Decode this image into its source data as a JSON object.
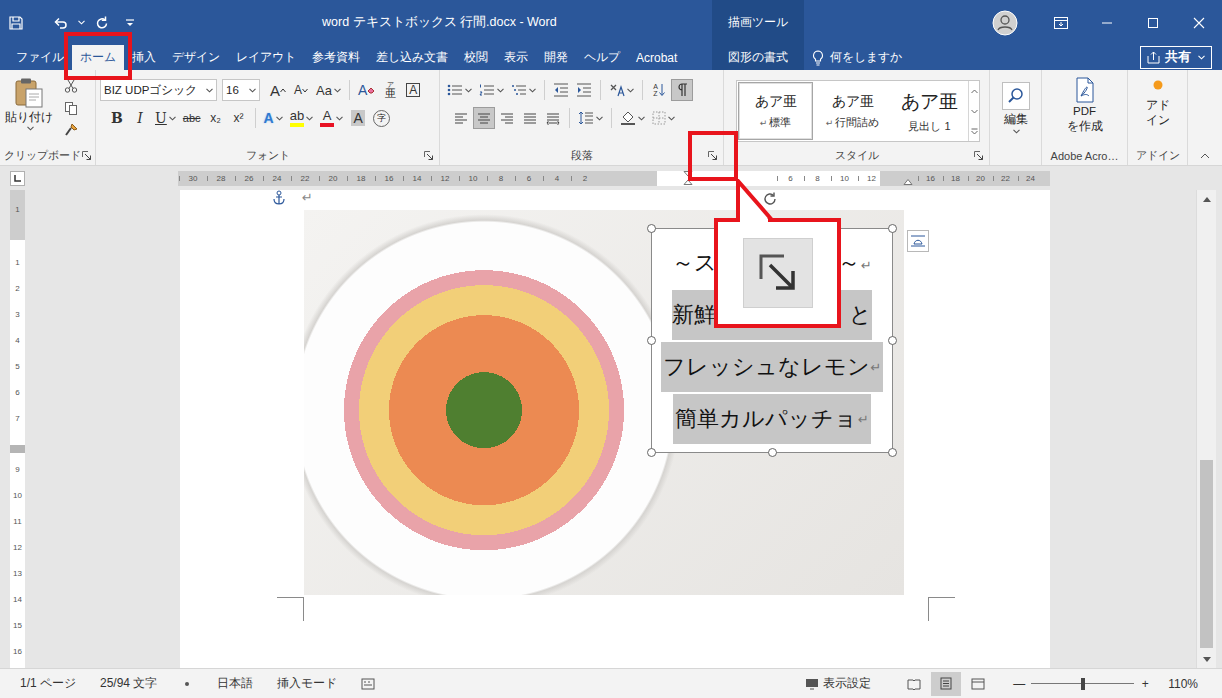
{
  "window": {
    "title": "word テキストボックス 行間.docx - Word",
    "context_group": "描画ツール"
  },
  "tabs": [
    {
      "label": "ファイル",
      "selected": false,
      "highlighted": false,
      "kind": "normal"
    },
    {
      "label": "ホーム",
      "selected": true,
      "highlighted": true,
      "kind": "normal"
    },
    {
      "label": "挿入",
      "selected": false,
      "highlighted": false,
      "kind": "normal"
    },
    {
      "label": "デザイン",
      "selected": false,
      "highlighted": false,
      "kind": "normal"
    },
    {
      "label": "レイアウト",
      "selected": false,
      "highlighted": false,
      "kind": "normal"
    },
    {
      "label": "参考資料",
      "selected": false,
      "highlighted": false,
      "kind": "normal"
    },
    {
      "label": "差し込み文書",
      "selected": false,
      "highlighted": false,
      "kind": "normal"
    },
    {
      "label": "校閲",
      "selected": false,
      "highlighted": false,
      "kind": "normal"
    },
    {
      "label": "表示",
      "selected": false,
      "highlighted": false,
      "kind": "normal"
    },
    {
      "label": "開発",
      "selected": false,
      "highlighted": false,
      "kind": "normal"
    },
    {
      "label": "ヘルプ",
      "selected": false,
      "highlighted": false,
      "kind": "normal"
    },
    {
      "label": "Acrobat",
      "selected": false,
      "highlighted": false,
      "kind": "normal"
    },
    {
      "label": "図形の書式",
      "selected": false,
      "highlighted": false,
      "kind": "contextual"
    }
  ],
  "tell_me": "何をしますか",
  "share": {
    "label": "共有"
  },
  "ribbon": {
    "clipboard": {
      "label": "クリップボード",
      "paste": "貼り付け"
    },
    "font": {
      "label": "フォント",
      "name": "BIZ UDPゴシック",
      "size": "16",
      "row1": [
        {
          "glyph": "A",
          "kind": "grow",
          "top": ""
        },
        {
          "glyph": "A",
          "kind": "shrink",
          "top": ""
        },
        {
          "glyph": "Aa",
          "kind": "case",
          "top": ""
        },
        {
          "glyph": "A",
          "kind": "clear",
          "top": ""
        },
        {
          "glyph": "亜",
          "kind": "ruby",
          "top": "ア"
        },
        {
          "glyph": "A",
          "kind": "border",
          "top": ""
        }
      ],
      "row2": [
        {
          "glyph": "B",
          "kind": "bold"
        },
        {
          "glyph": "I",
          "kind": "italic"
        },
        {
          "glyph": "U",
          "kind": "underline"
        },
        {
          "glyph": "abc",
          "kind": "strike"
        },
        {
          "glyph": "x₂",
          "kind": "sub"
        },
        {
          "glyph": "x²",
          "kind": "sup"
        }
      ],
      "effects": [
        {
          "glyph": "A",
          "kind": "effects",
          "color": "#2f7ad0"
        },
        {
          "glyph": "ab",
          "kind": "highlight",
          "color": "#ffff00"
        },
        {
          "glyph": "A",
          "kind": "font-color",
          "color": "#e81123"
        },
        {
          "glyph": "A",
          "kind": "shading",
          "color": "#c8c8c8"
        },
        {
          "glyph": "字",
          "kind": "enclose",
          "color": "#666666"
        }
      ]
    },
    "paragraph": {
      "label": "段落",
      "sort": [
        "A",
        "Z"
      ],
      "show_marks": true,
      "launcher_highlighted": true,
      "align": [
        {
          "selected": false
        },
        {
          "selected": true
        },
        {
          "selected": false
        },
        {
          "selected": false
        },
        {
          "selected": false
        }
      ]
    },
    "styles": {
      "label": "スタイル",
      "items": [
        {
          "sample": "あア亜",
          "name": "標準",
          "mark": "↵",
          "selected": true,
          "kind": "body"
        },
        {
          "sample": "あア亜",
          "name": "行間詰め",
          "mark": "↵",
          "selected": false,
          "kind": "body"
        },
        {
          "sample": "あア亜",
          "name": "見出し 1",
          "mark": "",
          "selected": false,
          "kind": "heading"
        }
      ]
    },
    "editing": {
      "label": "編集"
    },
    "acrobat": {
      "button": [
        "PDF",
        "を作成"
      ],
      "label": "Adobe Acro…"
    },
    "addins": {
      "button": [
        "アド",
        "イン"
      ],
      "label": "アドイン"
    }
  },
  "ruler": {
    "left": [
      "30",
      "28",
      "26",
      "24",
      "22",
      "20",
      "18",
      "16",
      "14",
      "12",
      "10",
      "8",
      "6",
      "4",
      "2"
    ],
    "middle": [
      "6",
      "8",
      "10",
      "12"
    ],
    "right": [
      "16",
      "18",
      "20",
      "22",
      "24"
    ]
  },
  "vruler": {
    "top": [
      "1"
    ],
    "upper": [
      "1",
      "2",
      "3",
      "4",
      "5",
      "6",
      "7"
    ],
    "lower": [
      "9",
      "10",
      "11",
      "12",
      "13",
      "14",
      "15",
      "16"
    ]
  },
  "document": {
    "mark": "↵",
    "textbox": {
      "lines": [
        {
          "head": "～ス",
          "tail": "～",
          "mark": "↵",
          "selected": false
        },
        {
          "head": "新鮮",
          "tail": "と",
          "mark": "",
          "selected": true
        },
        {
          "head": "フレッシュなレモン",
          "tail": "",
          "mark": "↵",
          "selected": true
        },
        {
          "head": "簡単カルパッチョ",
          "tail": "",
          "mark": "↵",
          "selected": true
        }
      ]
    }
  },
  "callout": {
    "shown": true
  },
  "scrollbar": {
    "level": 1
  },
  "status_bar": {
    "page": "1/1 ページ",
    "words": "25/94 文字",
    "language": "日本語",
    "mode": "挿入モード",
    "display_settings": "表示設定",
    "views": [
      {
        "selected": false
      },
      {
        "selected": true
      },
      {
        "selected": false
      }
    ],
    "zoom": {
      "minus": "—",
      "plus": "+",
      "level": 0.5,
      "reading": "110%"
    }
  }
}
